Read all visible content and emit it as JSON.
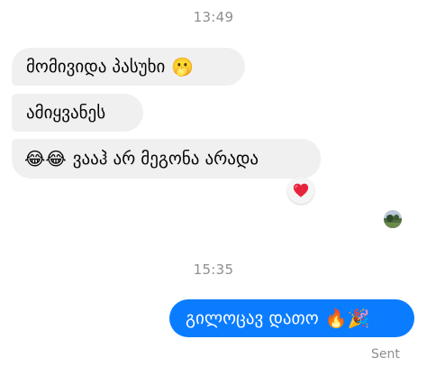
{
  "conversation": {
    "timestamps": [
      "13:49",
      "15:35"
    ],
    "incoming": [
      {
        "text": "მომივიდა პასუხი",
        "emoji": "🫢"
      },
      {
        "text": "ამიყვანეს"
      },
      {
        "text": "ვააჰ არ მეგონა არადა",
        "emoji_prefix": "😂😂"
      }
    ],
    "reaction": {
      "emoji": "❤️"
    },
    "outgoing": [
      {
        "text": "გილოცავ დათო",
        "emoji_suffix": "🔥🎉"
      }
    ],
    "status": "Sent"
  },
  "colors": {
    "incoming_bubble": "#f0f0f0",
    "outgoing_bubble": "#0a7cff",
    "timestamp_text": "#8e8e93",
    "heart": "#e8223a"
  },
  "icons": {
    "reaction": "heart-icon",
    "read_receipt": "avatar-read-receipt",
    "incoming_emoji": "face-with-hand-over-mouth-icon",
    "laugh": "tears-of-joy-icon",
    "fire": "fire-icon",
    "party": "party-popper-icon"
  }
}
